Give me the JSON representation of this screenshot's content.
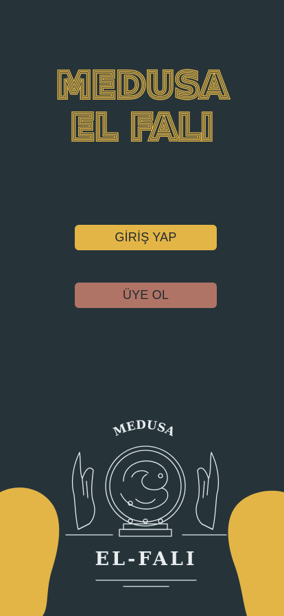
{
  "app": {
    "title_line1": "MEDUSA",
    "title_line2": "EL FALI"
  },
  "buttons": {
    "login_label": "GİRİŞ YAP",
    "signup_label": "ÜYE OL"
  },
  "logo": {
    "arc_text": "MEDUSA",
    "bottom_text": "EL-FALI"
  },
  "colors": {
    "background": "#26343a",
    "accent_yellow": "#e3b547",
    "signup_rose": "#b07466",
    "logo_line": "#e8ecef"
  }
}
